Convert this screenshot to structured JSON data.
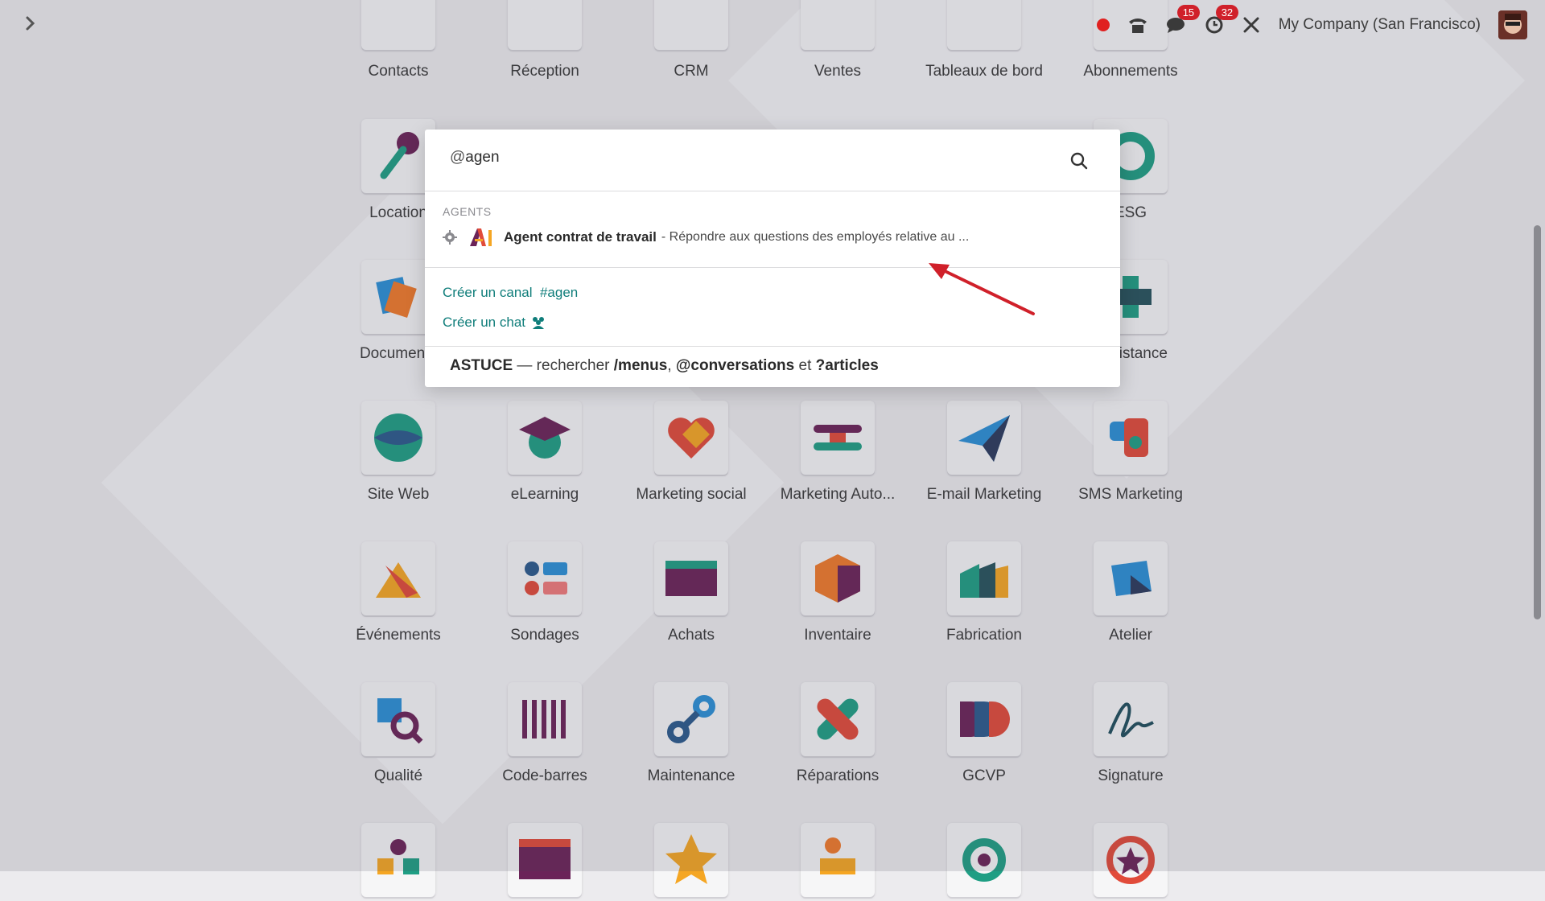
{
  "topbar": {
    "company": "My Company (San Francisco)",
    "messages_badge": "15",
    "activities_badge": "32"
  },
  "search": {
    "prefix": "@",
    "value": "agen",
    "section_title": "AGENTS",
    "agent": {
      "name": "Agent contrat de travail",
      "description": "- Répondre aux questions des employés relative au ..."
    },
    "create_channel_label": "Créer un canal",
    "create_channel_name": "#agen",
    "create_chat_label": "Créer un chat",
    "tip": {
      "label": "ASTUCE",
      "text1": " — rechercher ",
      "menus": "/menus",
      "sep": ", ",
      "conversations": "@conversations",
      "and": " et ",
      "articles": "?articles"
    }
  },
  "apps": [
    {
      "label": "Contacts"
    },
    {
      "label": "Réception"
    },
    {
      "label": "CRM"
    },
    {
      "label": "Ventes"
    },
    {
      "label": "Tableaux de bord"
    },
    {
      "label": "Abonnements"
    },
    {
      "label": "Location"
    },
    {
      "label": ""
    },
    {
      "label": ""
    },
    {
      "label": ""
    },
    {
      "label": ""
    },
    {
      "label": "ESG"
    },
    {
      "label": "Documents"
    },
    {
      "label": ""
    },
    {
      "label": ""
    },
    {
      "label": ""
    },
    {
      "label": ""
    },
    {
      "label": "Assistance"
    },
    {
      "label": "Site Web"
    },
    {
      "label": "eLearning"
    },
    {
      "label": "Marketing social"
    },
    {
      "label": "Marketing Auto..."
    },
    {
      "label": "E-mail Marketing"
    },
    {
      "label": "SMS Marketing"
    },
    {
      "label": "Événements"
    },
    {
      "label": "Sondages"
    },
    {
      "label": "Achats"
    },
    {
      "label": "Inventaire"
    },
    {
      "label": "Fabrication"
    },
    {
      "label": "Atelier"
    },
    {
      "label": "Qualité"
    },
    {
      "label": "Code-barres"
    },
    {
      "label": "Maintenance"
    },
    {
      "label": "Réparations"
    },
    {
      "label": "GCVP"
    },
    {
      "label": "Signature"
    },
    {
      "label": ""
    },
    {
      "label": ""
    },
    {
      "label": ""
    },
    {
      "label": ""
    },
    {
      "label": ""
    },
    {
      "label": ""
    }
  ],
  "colors": {
    "accent": "#0f7d7a",
    "badge": "#d0202a",
    "arrow": "#d0202a"
  }
}
